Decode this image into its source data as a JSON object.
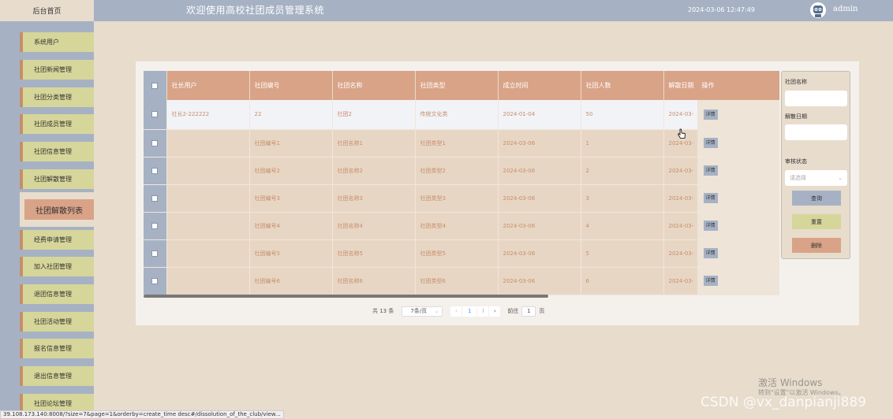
{
  "header": {
    "home_tab": "后台首页",
    "title": "欢迎使用高校社团成员管理系统",
    "datetime": "2024-03-06 12:47:49",
    "username": "admin"
  },
  "sidebar": {
    "items": [
      {
        "label": "系统用户"
      },
      {
        "label": "社团新闻管理"
      },
      {
        "label": "社团分类管理"
      },
      {
        "label": "社团成员管理"
      },
      {
        "label": "社团信息管理"
      },
      {
        "label": "社团解散管理"
      },
      {
        "label": "社团解散列表",
        "active": true
      },
      {
        "label": "经费申请管理"
      },
      {
        "label": "加入社团管理"
      },
      {
        "label": "退团信息管理"
      },
      {
        "label": "社团活动管理"
      },
      {
        "label": "报名信息管理"
      },
      {
        "label": "退出信息管理"
      },
      {
        "label": "社团论坛管理"
      }
    ]
  },
  "table": {
    "columns": [
      "社长用户",
      "社团编号",
      "社团名称",
      "社团类型",
      "成立时间",
      "社团人数",
      "解散日期",
      "操作"
    ],
    "detail_label": "详情",
    "rows": [
      {
        "user": "社长2-222222",
        "code": "22",
        "name": "社团2",
        "type": "传统文化类",
        "date": "2024-01-04",
        "count": "50",
        "dissolve": "2024-03-"
      },
      {
        "user": "",
        "code": "社团编号1",
        "name": "社团名称1",
        "type": "社团类型1",
        "date": "2024-03-06",
        "count": "1",
        "dissolve": "2024-03-"
      },
      {
        "user": "",
        "code": "社团编号2",
        "name": "社团名称2",
        "type": "社团类型2",
        "date": "2024-03-06",
        "count": "2",
        "dissolve": "2024-03-"
      },
      {
        "user": "",
        "code": "社团编号3",
        "name": "社团名称3",
        "type": "社团类型3",
        "date": "2024-03-06",
        "count": "3",
        "dissolve": "2024-03-"
      },
      {
        "user": "",
        "code": "社团编号4",
        "name": "社团名称4",
        "type": "社团类型4",
        "date": "2024-03-06",
        "count": "4",
        "dissolve": "2024-03-"
      },
      {
        "user": "",
        "code": "社团编号5",
        "name": "社团名称5",
        "type": "社团类型5",
        "date": "2024-03-06",
        "count": "5",
        "dissolve": "2024-03-"
      },
      {
        "user": "",
        "code": "社团编号6",
        "name": "社团名称6",
        "type": "社团类型6",
        "date": "2024-03-06",
        "count": "6",
        "dissolve": "2024-03-"
      }
    ]
  },
  "pagination": {
    "total": "共 13 条",
    "page_size": "7条/页",
    "current_page": "1",
    "prev": "‹",
    "next": "›",
    "goto_label": "前往",
    "goto_value": "1",
    "page_suffix": "页"
  },
  "search": {
    "name_label": "社团名称",
    "date_label": "解散日期",
    "status_label": "审核状态",
    "status_placeholder": "请选择",
    "query_btn": "查询",
    "reset_btn": "重置",
    "delete_btn": "删除"
  },
  "colors": {
    "sidebar_bg": "#a6b2c4",
    "menu_item": "#d6d69a",
    "header_orange": "#d9a387",
    "page_bg": "#e8dccd"
  },
  "overlay": {
    "status_url": "39.108.173.140:8008/?size=7&page=1&orderby=create_time desc#/dissolution_of_the_club/view...",
    "win_line1": "激活 Windows",
    "win_line2": "转到\"设置\"以激活 Windows。",
    "csdn": "CSDN @vx_danpianji889"
  }
}
